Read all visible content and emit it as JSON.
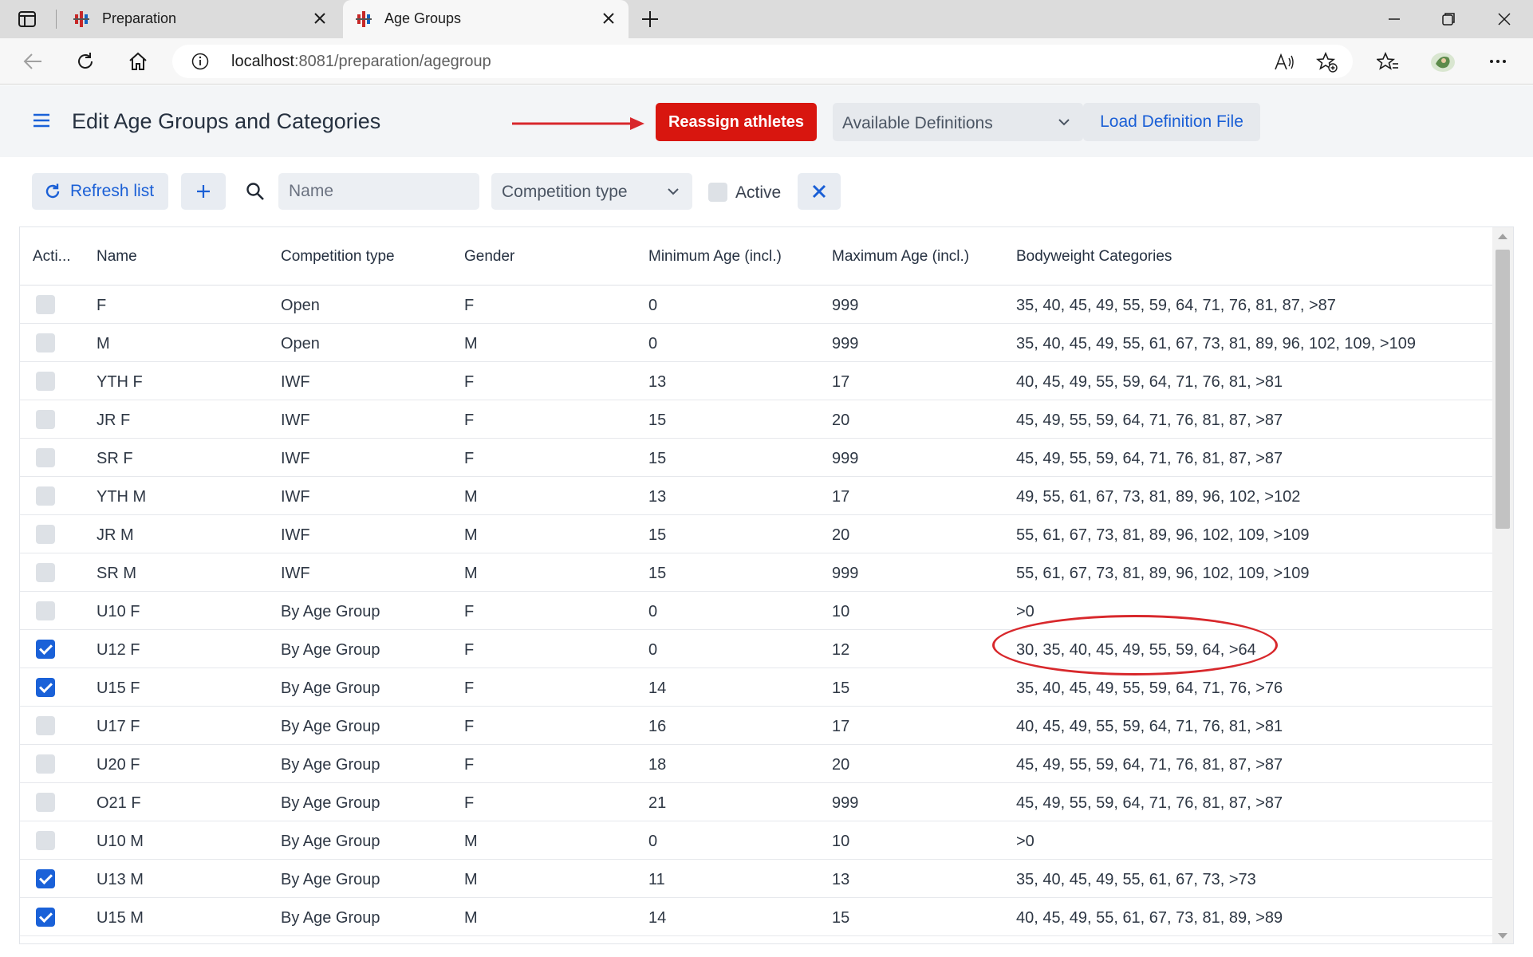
{
  "browser": {
    "tabs": [
      {
        "title": "Preparation",
        "active": false
      },
      {
        "title": "Age Groups",
        "active": true
      }
    ],
    "url_host": "localhost",
    "url_rest": ":8081/preparation/agegroup"
  },
  "header": {
    "title": "Edit Age Groups and Categories",
    "reassign_label": "Reassign athletes",
    "definitions_placeholder": "Available Definitions",
    "load_label": "Load Definition File"
  },
  "toolbar": {
    "refresh_label": "Refresh list",
    "add_label": "+",
    "name_placeholder": "Name",
    "competition_type_placeholder": "Competition type",
    "active_label": "Active"
  },
  "grid": {
    "columns": [
      "Acti...",
      "Name",
      "Competition type",
      "Gender",
      "Minimum Age (incl.)",
      "Maximum Age (incl.)",
      "Bodyweight Categories"
    ],
    "rows": [
      {
        "active": false,
        "name": "F",
        "comp": "Open",
        "gender": "F",
        "min": "0",
        "max": "999",
        "bw": "35, 40, 45, 49, 55, 59, 64, 71, 76, 81, 87, >87"
      },
      {
        "active": false,
        "name": "M",
        "comp": "Open",
        "gender": "M",
        "min": "0",
        "max": "999",
        "bw": "35, 40, 45, 49, 55, 61, 67, 73, 81, 89, 96, 102, 109, >109"
      },
      {
        "active": false,
        "name": "YTH F",
        "comp": "IWF",
        "gender": "F",
        "min": "13",
        "max": "17",
        "bw": "40, 45, 49, 55, 59, 64, 71, 76, 81, >81"
      },
      {
        "active": false,
        "name": "JR F",
        "comp": "IWF",
        "gender": "F",
        "min": "15",
        "max": "20",
        "bw": "45, 49, 55, 59, 64, 71, 76, 81, 87, >87"
      },
      {
        "active": false,
        "name": "SR F",
        "comp": "IWF",
        "gender": "F",
        "min": "15",
        "max": "999",
        "bw": "45, 49, 55, 59, 64, 71, 76, 81, 87, >87"
      },
      {
        "active": false,
        "name": "YTH M",
        "comp": "IWF",
        "gender": "M",
        "min": "13",
        "max": "17",
        "bw": "49, 55, 61, 67, 73, 81, 89, 96, 102, >102"
      },
      {
        "active": false,
        "name": "JR M",
        "comp": "IWF",
        "gender": "M",
        "min": "15",
        "max": "20",
        "bw": "55, 61, 67, 73, 81, 89, 96, 102, 109, >109"
      },
      {
        "active": false,
        "name": "SR M",
        "comp": "IWF",
        "gender": "M",
        "min": "15",
        "max": "999",
        "bw": "55, 61, 67, 73, 81, 89, 96, 102, 109, >109"
      },
      {
        "active": false,
        "name": "U10 F",
        "comp": "By Age Group",
        "gender": "F",
        "min": "0",
        "max": "10",
        "bw": ">0"
      },
      {
        "active": true,
        "name": "U12 F",
        "comp": "By Age Group",
        "gender": "F",
        "min": "0",
        "max": "12",
        "bw": "30, 35, 40, 45, 49, 55, 59, 64, >64"
      },
      {
        "active": true,
        "name": "U15 F",
        "comp": "By Age Group",
        "gender": "F",
        "min": "14",
        "max": "15",
        "bw": "35, 40, 45, 49, 55, 59, 64, 71, 76, >76"
      },
      {
        "active": false,
        "name": "U17 F",
        "comp": "By Age Group",
        "gender": "F",
        "min": "16",
        "max": "17",
        "bw": "40, 45, 49, 55, 59, 64, 71, 76, 81, >81"
      },
      {
        "active": false,
        "name": "U20 F",
        "comp": "By Age Group",
        "gender": "F",
        "min": "18",
        "max": "20",
        "bw": "45, 49, 55, 59, 64, 71, 76, 81, 87, >87"
      },
      {
        "active": false,
        "name": "O21 F",
        "comp": "By Age Group",
        "gender": "F",
        "min": "21",
        "max": "999",
        "bw": "45, 49, 55, 59, 64, 71, 76, 81, 87, >87"
      },
      {
        "active": false,
        "name": "U10 M",
        "comp": "By Age Group",
        "gender": "M",
        "min": "0",
        "max": "10",
        "bw": ">0"
      },
      {
        "active": true,
        "name": "U13 M",
        "comp": "By Age Group",
        "gender": "M",
        "min": "11",
        "max": "13",
        "bw": "35, 40, 45, 49, 55, 61, 67, 73, >73"
      },
      {
        "active": true,
        "name": "U15 M",
        "comp": "By Age Group",
        "gender": "M",
        "min": "14",
        "max": "15",
        "bw": "40, 45, 49, 55, 61, 67, 73, 81, 89, >89"
      }
    ]
  },
  "colors": {
    "accent_blue": "#1a61d8",
    "reassign_red": "#d8160f",
    "annotation_red": "#d8282c"
  }
}
